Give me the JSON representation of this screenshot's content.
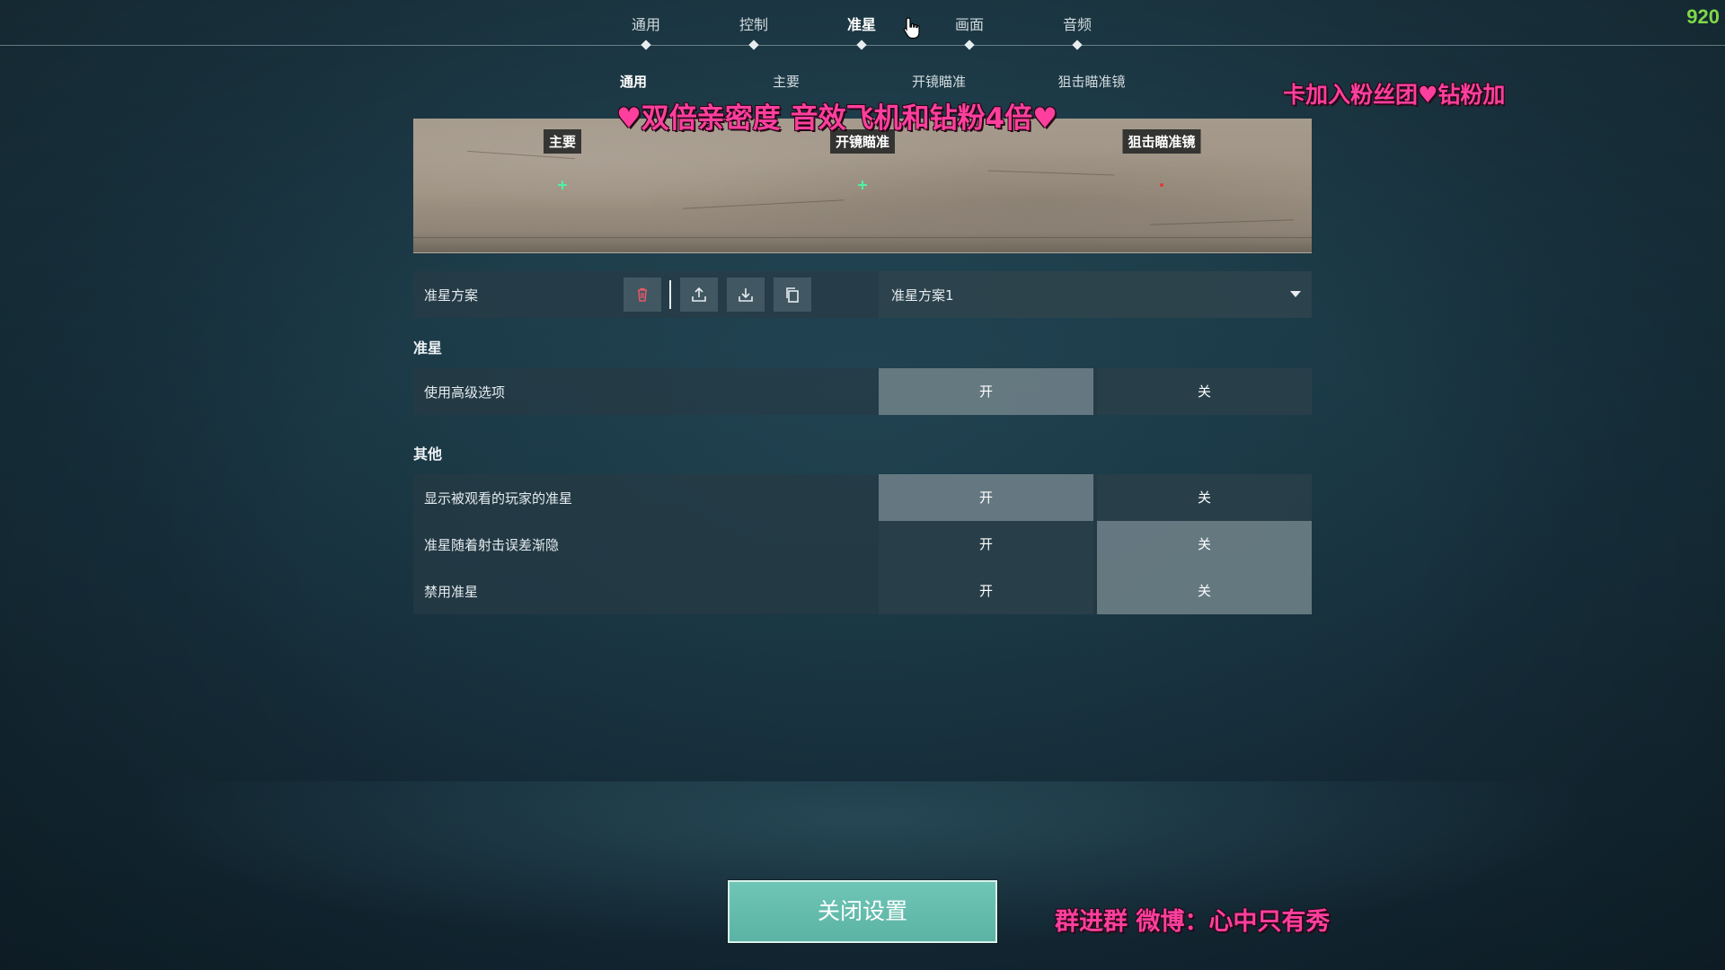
{
  "fps": "920",
  "top_tabs": [
    {
      "label": "通用"
    },
    {
      "label": "控制"
    },
    {
      "label": "准星",
      "active": true
    },
    {
      "label": "画面"
    },
    {
      "label": "音频"
    }
  ],
  "sub_tabs": [
    {
      "label": "通用",
      "active": true
    },
    {
      "label": "主要"
    },
    {
      "label": "开镜瞄准"
    },
    {
      "label": "狙击瞄准镜"
    }
  ],
  "overlays": {
    "banner": "♥双倍亲密度 音效飞机和钻粉4倍♥",
    "right_marquee": "卡加入粉丝团♥钻粉加",
    "bottom_marquee": "群进群  微博：心中只有秀"
  },
  "preview": {
    "labels": [
      "主要",
      "开镜瞄准",
      "狙击瞄准镜"
    ]
  },
  "profile": {
    "label": "准星方案",
    "selected": "准星方案1",
    "icons": [
      "trash-icon",
      "upload-icon",
      "download-icon",
      "copy-icon"
    ]
  },
  "sections": {
    "crosshair_title": "准星",
    "other_title": "其他"
  },
  "toggle_on": "开",
  "toggle_off": "关",
  "options": {
    "advanced": {
      "label": "使用高级选项",
      "value": "开"
    },
    "show_spectated": {
      "label": "显示被观看的玩家的准星",
      "value": "开"
    },
    "fade_with_error": {
      "label": "准星随着射击误差渐隐",
      "value": "关"
    },
    "disable_crosshair": {
      "label": "禁用准星",
      "value": "关"
    }
  },
  "close_button": "关闭设置",
  "colors": {
    "accent_teal": "#5bb3a4",
    "fps_green": "#7fd84a",
    "overlay_pink": "#ff3f9e",
    "crosshair_green": "#4cf2a2",
    "crosshair_red": "#e03a3a"
  }
}
